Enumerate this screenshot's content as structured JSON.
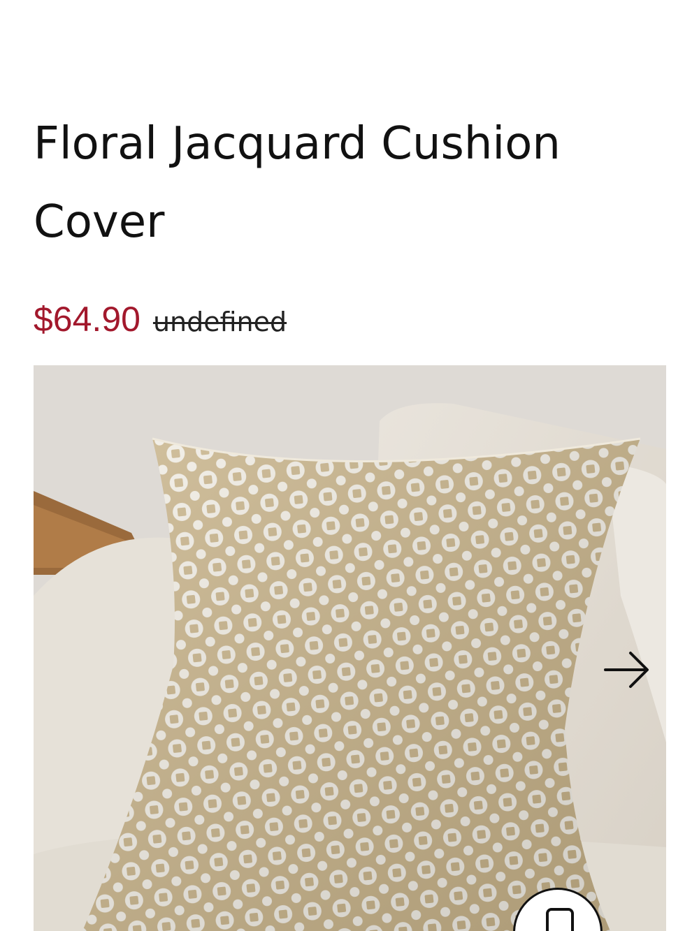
{
  "product": {
    "title": "Floral Jacquard Cushion Cover",
    "price_current": "$64.90",
    "price_original": "undefined"
  },
  "colors": {
    "price_accent": "#a2182c",
    "text": "#111111"
  },
  "gallery": {
    "image_icon": "cushion-photo",
    "next_icon": "arrow-right-icon",
    "fab_icon": "phone-icon"
  }
}
